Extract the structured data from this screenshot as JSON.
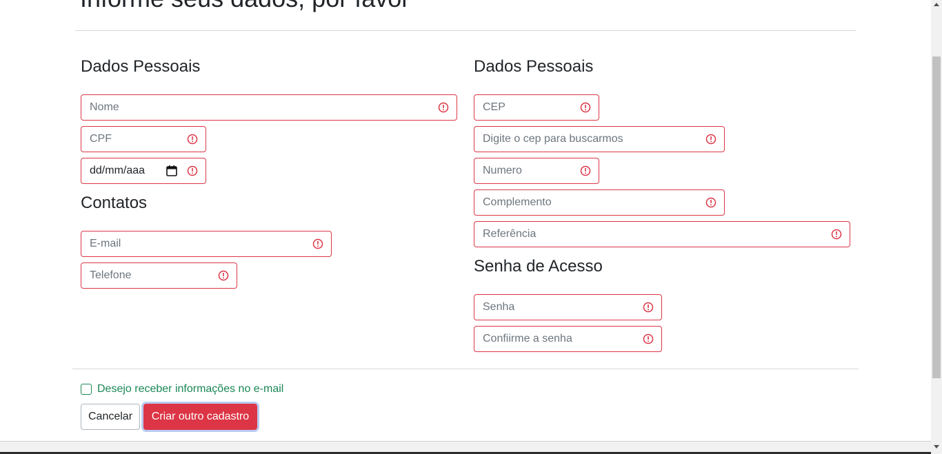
{
  "page": {
    "title": "Informe seus dados, por favor"
  },
  "personal": {
    "title": "Dados Pessoais",
    "name_placeholder": "Nome",
    "cpf_placeholder": "CPF",
    "birthdate_placeholder": "dd/mm/aaa"
  },
  "contacts": {
    "title": "Contatos",
    "email_placeholder": "E-mail",
    "phone_placeholder": "Telefone"
  },
  "address": {
    "title": "Dados Pessoais",
    "cep_placeholder": "CEP",
    "street_placeholder": "Digite o cep para buscarmos",
    "number_placeholder": "Numero",
    "complement_placeholder": "Complemento",
    "reference_placeholder": "Referência"
  },
  "access": {
    "title": "Senha de Acesso",
    "password_placeholder": "Senha",
    "confirm_placeholder": "Confiirme a senha"
  },
  "newsletter": {
    "label": "Desejo receber informações no e-mail",
    "checked": false
  },
  "actions": {
    "cancel_label": "Cancelar",
    "create_label": "Criar outro cadastro"
  },
  "colors": {
    "error": "#dc3545",
    "success": "#198754",
    "primary_button": "#dc3545"
  },
  "icons": {
    "field_error": "exclamation-circle-icon",
    "date_picker": "calendar-icon"
  }
}
